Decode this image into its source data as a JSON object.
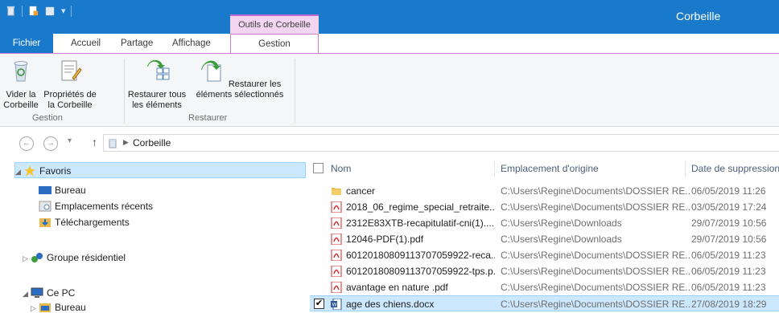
{
  "window": {
    "title": "Corbeille",
    "context_tab_title": "Outils de Corbeille"
  },
  "ribbon_tabs": {
    "file": "Fichier",
    "home": "Accueil",
    "share": "Partage",
    "view": "Affichage",
    "manage": "Gestion"
  },
  "ribbon": {
    "empty_bin": "Vider la Corbeille",
    "bin_properties": "Propriétés de la Corbeille",
    "group_manage": "Gestion",
    "restore_all": "Restaurer tous les éléments",
    "restore_selected": "Restaurer les éléments sélectionnés",
    "group_restore": "Restaurer"
  },
  "address": {
    "location": "Corbeille"
  },
  "nav": {
    "favorites": "Favoris",
    "desktop": "Bureau",
    "recent": "Emplacements récents",
    "downloads": "Téléchargements",
    "homegroup": "Groupe résidentiel",
    "this_pc": "Ce PC",
    "pc_desktop": "Bureau"
  },
  "columns": {
    "name": "Nom",
    "origin": "Emplacement d'origine",
    "deleted": "Date de suppression"
  },
  "files": [
    {
      "name": "cancer",
      "type": "folder",
      "origin": "C:\\Users\\Regine\\Documents\\DOSSIER RE...",
      "deleted": "06/05/2019 11:26"
    },
    {
      "name": "2018_06_regime_special_retraite...",
      "type": "pdf",
      "origin": "C:\\Users\\Regine\\Documents\\DOSSIER RE...",
      "deleted": "03/05/2019 17:24"
    },
    {
      "name": "2312E83XTB-recapitulatif-cni(1)....",
      "type": "pdf",
      "origin": "C:\\Users\\Regine\\Downloads",
      "deleted": "29/07/2019 10:56"
    },
    {
      "name": "12046-PDF(1).pdf",
      "type": "pdf",
      "origin": "C:\\Users\\Regine\\Downloads",
      "deleted": "29/07/2019 10:56"
    },
    {
      "name": "60120180809113707059922-reca...",
      "type": "pdf",
      "origin": "C:\\Users\\Regine\\Documents\\DOSSIER RE...",
      "deleted": "06/05/2019 11:23"
    },
    {
      "name": "60120180809113707059922-tps.p...",
      "type": "pdf",
      "origin": "C:\\Users\\Regine\\Documents\\DOSSIER RE...",
      "deleted": "06/05/2019 11:23"
    },
    {
      "name": "avantage en nature .pdf",
      "type": "pdf",
      "origin": "C:\\Users\\Regine\\Documents\\DOSSIER RE...",
      "deleted": "06/05/2019 11:23"
    },
    {
      "name": "age des chiens.docx",
      "type": "docx",
      "origin": "C:\\Users\\Regine\\Documents\\DOSSIER RE...",
      "deleted": "27/08/2019 18:29",
      "selected": true
    }
  ],
  "colors": {
    "titlebar": "#1979ca",
    "context": "#f3d5f2",
    "selection": "#cce8ff",
    "pdf": "#d12a2a",
    "folder": "#e8b84a"
  }
}
